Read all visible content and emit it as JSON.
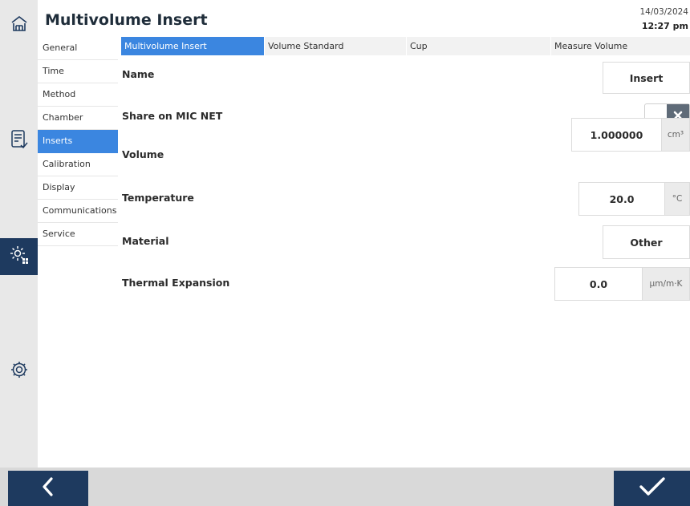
{
  "header": {
    "title": "Multivolume Insert",
    "date": "14/03/2024",
    "time": "12:27 pm"
  },
  "rail": {
    "icons": [
      "home-icon",
      "checklist-icon",
      "settings-grid-icon",
      "settings-icon"
    ]
  },
  "menu": {
    "items": [
      {
        "label": "General"
      },
      {
        "label": "Time"
      },
      {
        "label": "Method"
      },
      {
        "label": "Chamber"
      },
      {
        "label": "Inserts"
      },
      {
        "label": "Calibration"
      },
      {
        "label": "Display"
      },
      {
        "label": "Communications"
      },
      {
        "label": "Service"
      }
    ],
    "active": "Inserts"
  },
  "tabs": {
    "items": [
      {
        "label": "Multivolume Insert"
      },
      {
        "label": "Volume Standard"
      },
      {
        "label": "Cup"
      },
      {
        "label": "Measure Volume"
      }
    ],
    "active": "Multivolume Insert"
  },
  "form": {
    "name": {
      "label": "Name",
      "value": "Insert"
    },
    "share": {
      "label": "Share on MIC NET",
      "state": "off"
    },
    "volume": {
      "label": "Volume",
      "value": "1.000000",
      "unit": "cm³"
    },
    "temperature": {
      "label": "Temperature",
      "value": "20.0",
      "unit": "°C"
    },
    "material": {
      "label": "Material",
      "value": "Other"
    },
    "thermal": {
      "label": "Thermal Expansion",
      "value": "0.0",
      "unit": "µm/m·K"
    }
  },
  "colors": {
    "accent": "#3b86e0",
    "dark": "#1e3a5f",
    "rail_bg": "#e8e8e8",
    "footer_bg": "#d9d9d9"
  }
}
